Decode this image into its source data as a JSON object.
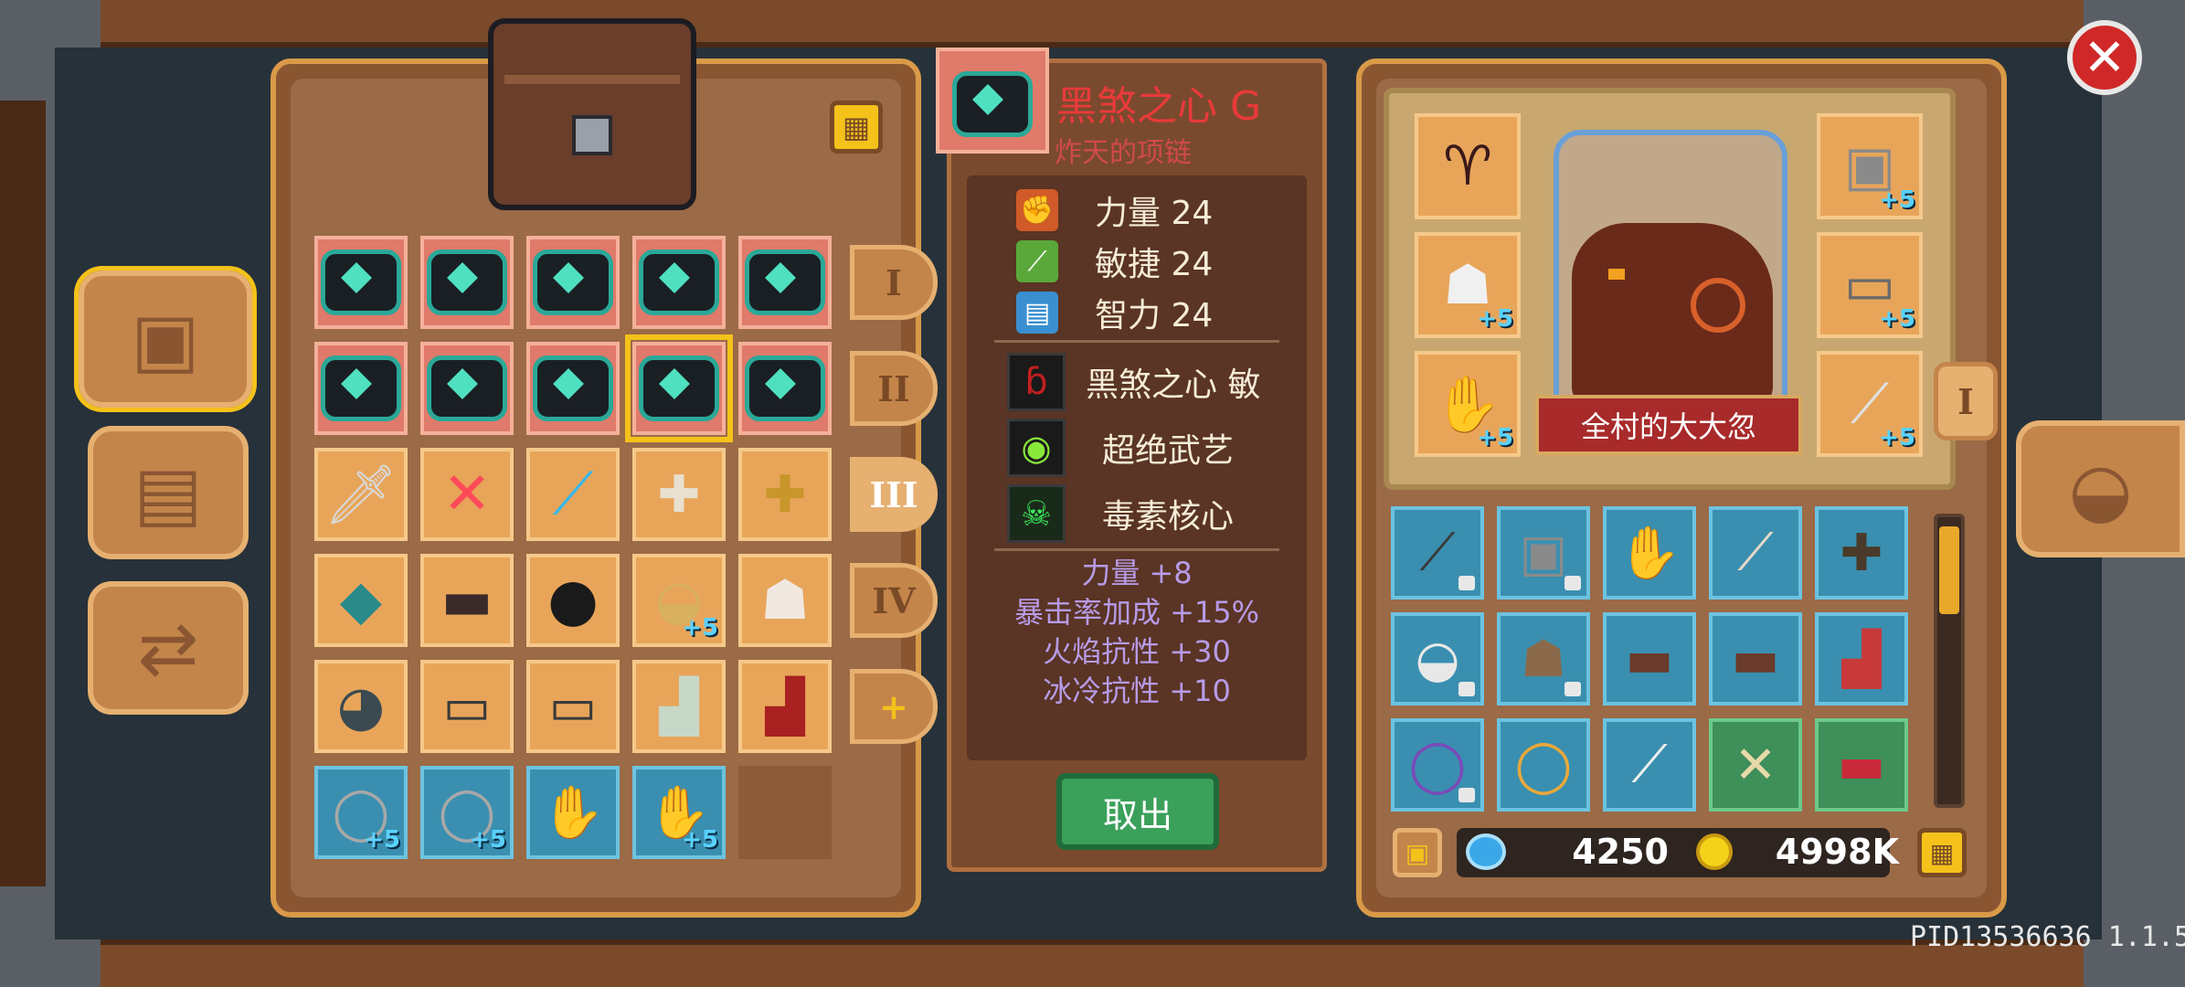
{
  "item_detail": {
    "name": "黑煞之心 G",
    "subtitle": "炸天的项链",
    "stats": [
      {
        "icon": "fist-icon",
        "label": "力量 24",
        "color": "#d05a28"
      },
      {
        "icon": "feather-icon",
        "label": "敏捷 24",
        "color": "#5aa83a"
      },
      {
        "icon": "book-icon",
        "label": "智力 24",
        "color": "#3a8fd0"
      }
    ],
    "skills": [
      {
        "icon": "dark-flame-icon",
        "label": "黑煞之心 敏"
      },
      {
        "icon": "martial-orb-icon",
        "label": "超绝武艺"
      },
      {
        "icon": "toxic-skull-icon",
        "label": "毒素核心"
      }
    ],
    "bonuses": [
      "力量 +8",
      "暴击率加成 +15%",
      "火焰抗性 +30",
      "冰冷抗性 +10"
    ],
    "take_out_label": "取出"
  },
  "storage_tabs": [
    "I",
    "II",
    "III",
    "IV",
    "+"
  ],
  "character": {
    "name": "全村的大大忽",
    "side_tab": "I"
  },
  "currency": {
    "gems": "4250",
    "gold": "4998K"
  },
  "player_id": "PID13536636 1.1.5",
  "plus_label": "+5"
}
